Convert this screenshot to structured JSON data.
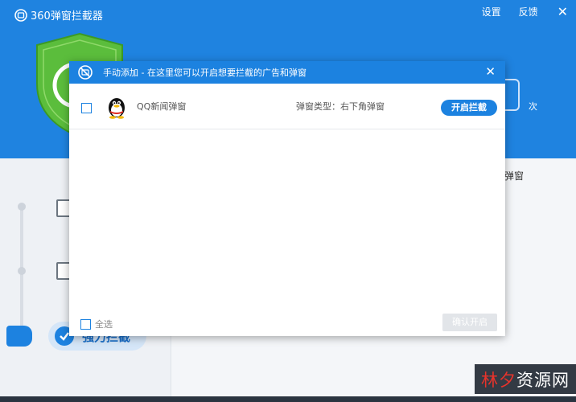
{
  "app": {
    "title": "360弹窗拦截器",
    "settings_label": "设置",
    "feedback_label": "反馈",
    "close_symbol": "✕",
    "count_suffix": "次",
    "side_text": "弹窗",
    "mode_label": "强力拦截"
  },
  "dialog": {
    "title": "手动添加 - 在这里您可以开启想要拦截的广告和弹窗",
    "close_symbol": "✕",
    "rows": [
      {
        "name": "QQ新闻弹窗",
        "type_text": "弹窗类型：右下角弹窗",
        "button_label": "开启拦截",
        "icon": "qq-penguin-icon",
        "checked": false
      }
    ],
    "select_all_label": "全选",
    "confirm_label": "确认开启"
  },
  "watermark": {
    "part1": "林夕",
    "part2": "资源网"
  },
  "colors": {
    "primary": "#1c82e0",
    "header_bg": "#1f83e0",
    "shield_green": "#5bbd3c"
  }
}
